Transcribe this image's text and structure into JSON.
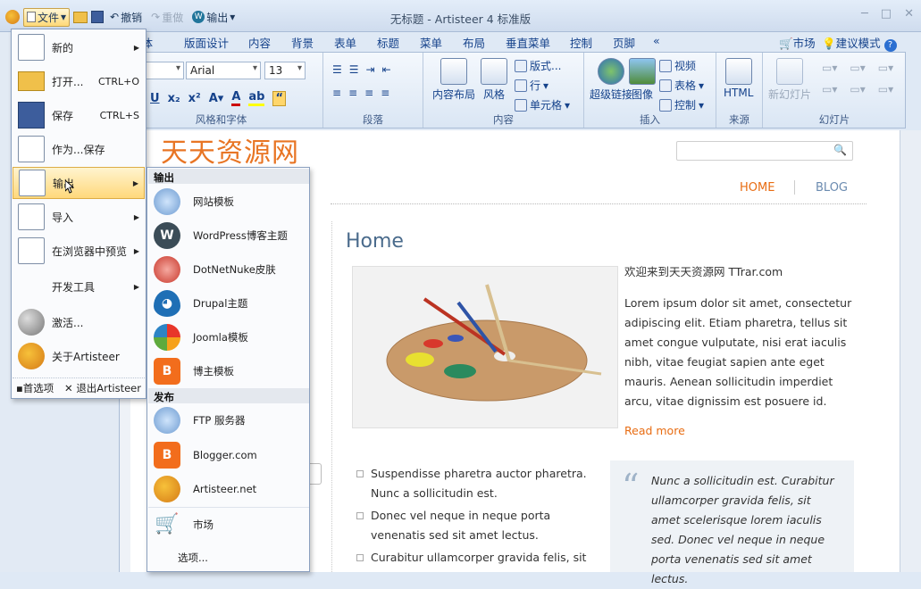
{
  "window": {
    "title": "无标题 - Artisteer 4 标准版"
  },
  "qat": {
    "file": "文件",
    "undo": "撤销",
    "redo": "重做",
    "export": "输出"
  },
  "tabs": [
    "字体",
    "版面设计",
    "内容",
    "背景",
    "表单",
    "标题",
    "菜单",
    "布局",
    "垂直菜单",
    "控制",
    "页脚",
    "«"
  ],
  "topright": {
    "market": "市场",
    "suggest": "建议模式"
  },
  "ribbon": {
    "font_name": "Arial",
    "font_size": "13",
    "group_font": "风格和字体",
    "group_para": "段落",
    "group_content": "内容",
    "group_insert": "插入",
    "group_source": "来源",
    "group_slides": "幻灯片",
    "content_layout": "内容布局",
    "style": "风格",
    "format": "版式...",
    "row": "行",
    "cell": "单元格",
    "hyperlink": "超级链接",
    "image": "图像",
    "video": "视频",
    "table": "表格",
    "control": "控制",
    "html": "HTML",
    "new_slide": "新幻灯片"
  },
  "site": {
    "title": "天天资源网",
    "nav_home": "HOME",
    "nav_blog": "BLOG",
    "heading": "Home",
    "welcome": "欢迎来到天天资源网 TTrar.com",
    "lorem": "Lorem ipsum dolor sit amet, consectetur adipiscing elit. Etiam pharetra, tellus sit amet congue vulputate, nisi erat iaculis nibh, vitae feugiat sapien ante eget mauris. Aenean sollicitudin imperdiet arcu, vitae dignissim est posuere id.",
    "readmore": "Read more",
    "bullets": [
      "Suspendisse pharetra auctor pharetra. Nunc a sollicitudin est.",
      "Donec vel neque in neque porta venenatis sed sit amet lectus.",
      "Curabitur ullamcorper gravida felis, sit"
    ],
    "quote": "Nunc a sollicitudin est. Curabitur ullamcorper gravida felis, sit amet scelerisque lorem iaculis sed. Donec vel neque in neque porta venenatis sed sit amet lectus."
  },
  "filemenu": {
    "items": [
      {
        "label": "新的",
        "shortcut": "",
        "arrow": "▶"
      },
      {
        "label": "打开...",
        "shortcut": "CTRL+O",
        "arrow": ""
      },
      {
        "label": "保存",
        "shortcut": "CTRL+S",
        "arrow": ""
      },
      {
        "label": "作为...保存",
        "shortcut": "",
        "arrow": ""
      },
      {
        "label": "输出",
        "shortcut": "",
        "arrow": "▶"
      },
      {
        "label": "导入",
        "shortcut": "",
        "arrow": "▶"
      },
      {
        "label": "在浏览器中预览",
        "shortcut": "",
        "arrow": "▶"
      },
      {
        "label": "开发工具",
        "shortcut": "",
        "arrow": "▶"
      },
      {
        "label": "激活...",
        "shortcut": "",
        "arrow": ""
      },
      {
        "label": "关于Artisteer",
        "shortcut": "",
        "arrow": ""
      }
    ],
    "options": "首选项",
    "exit": "退出Artisteer"
  },
  "submenu": {
    "export_header": "输出",
    "export_items": [
      "网站模板",
      "WordPress博客主题",
      "DotNetNuke皮肤",
      "Drupal主题",
      "Joomla模板",
      "博主模板"
    ],
    "publish_header": "发布",
    "publish_items": [
      "FTP 服务器",
      "Blogger.com",
      "Artisteer.net",
      "市场"
    ],
    "options": "选项..."
  }
}
